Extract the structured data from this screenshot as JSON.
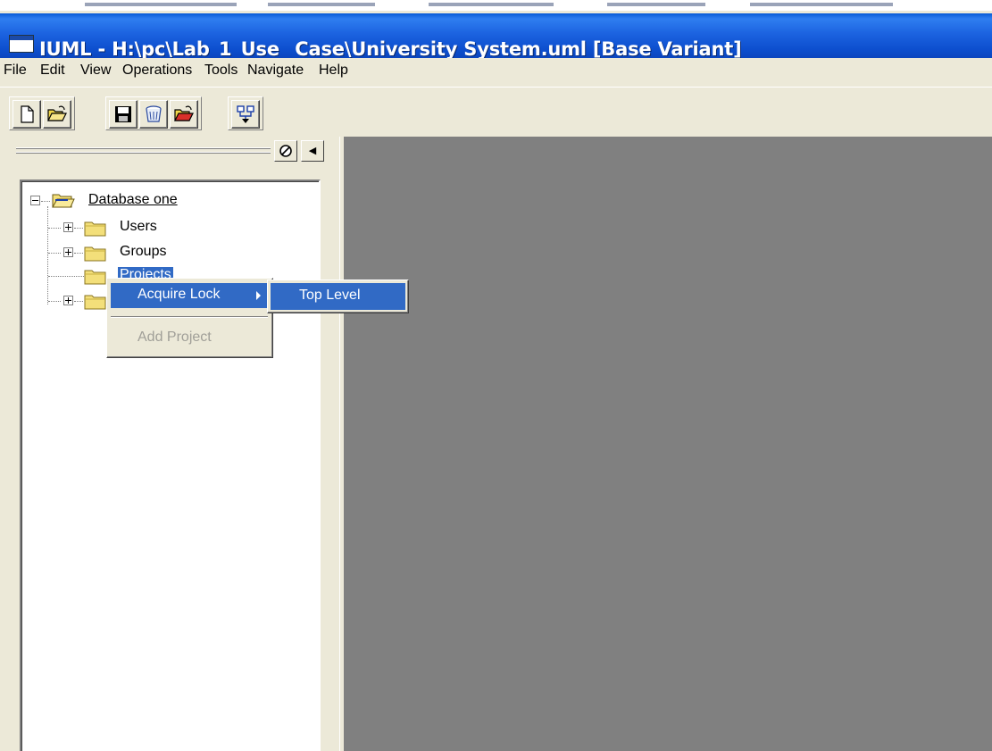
{
  "window": {
    "title": "IUML - H:\\pc\\Lab_1_Use _Case\\University System.uml [Base Variant]"
  },
  "menubar": {
    "items": [
      "File",
      "Edit",
      "View",
      "Operations",
      "Tools",
      "Navigate",
      "Help"
    ]
  },
  "toolbar": {
    "buttons": [
      {
        "icon": "new-document-icon"
      },
      {
        "icon": "open-folder-icon"
      },
      {
        "icon": "save-disk-icon"
      },
      {
        "icon": "recycle-bin-icon"
      },
      {
        "icon": "open-red-folder-icon"
      },
      {
        "icon": "diagram-tree-icon"
      }
    ]
  },
  "tree": {
    "root": "Database one",
    "children": [
      {
        "label": "Users",
        "expandable": true
      },
      {
        "label": "Groups",
        "expandable": true
      },
      {
        "label": "Projects",
        "expandable": false,
        "selected": true
      },
      {
        "label": "",
        "expandable": true
      }
    ]
  },
  "context_menu": {
    "items": [
      {
        "label": "Acquire Lock",
        "has_submenu": true,
        "active": true
      },
      {
        "label": "Add Project",
        "disabled": true
      }
    ],
    "submenu": {
      "items": [
        {
          "label": "Top Level",
          "active": true
        }
      ]
    }
  },
  "colors": {
    "titlebar": "#0d4fcf",
    "selection": "#316ac5",
    "workspace": "#808080",
    "face": "#ece9d8"
  }
}
